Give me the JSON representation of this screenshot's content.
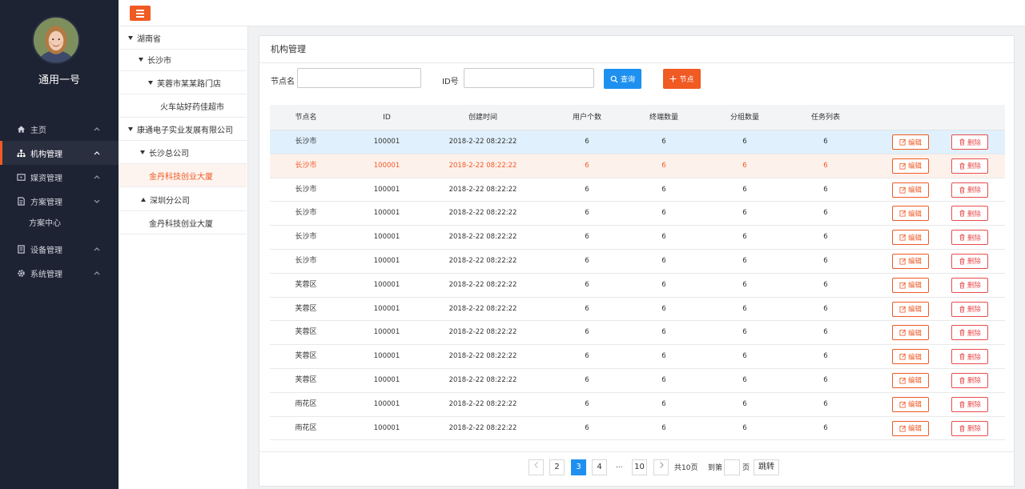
{
  "user": {
    "name": "通用一号"
  },
  "colors": {
    "accent": "#f05a23",
    "primary": "#1e90f0",
    "sidebar": "#1e2333",
    "danger": "#e84d4d"
  },
  "nav": {
    "items": [
      {
        "label": "主页",
        "icon": "home-icon"
      },
      {
        "label": "机构管理",
        "icon": "org-tree-icon"
      },
      {
        "label": "媒资管理",
        "icon": "media-icon"
      },
      {
        "label": "方案管理",
        "icon": "document-icon"
      },
      {
        "label": "方案中心"
      },
      {
        "label": "设备管理",
        "icon": "device-icon"
      },
      {
        "label": "系统管理",
        "icon": "gear-icon"
      }
    ]
  },
  "tree": {
    "nodes": [
      {
        "label": "湖南省",
        "state": "expanded"
      },
      {
        "label": "长沙市",
        "state": "expanded"
      },
      {
        "label": "芙蓉市某某路门店",
        "state": "expanded"
      },
      {
        "label": "火车站好药佳超市",
        "state": "leaf"
      },
      {
        "label": "康通电子实业发展有限公司",
        "state": "expanded"
      },
      {
        "label": "长沙总公司",
        "state": "expanded"
      },
      {
        "label": "金丹科技创业大厦",
        "state": "selected"
      },
      {
        "label": "深圳分公司",
        "state": "collapsed"
      },
      {
        "label": "金丹科技创业大厦",
        "state": "leaf"
      }
    ]
  },
  "panel": {
    "title": "机构管理"
  },
  "search": {
    "name_label": "节点名",
    "name_value": "",
    "id_label": "ID号",
    "id_value": "",
    "query_label": "查询",
    "add_label": "节点"
  },
  "table": {
    "headers": [
      "节点名",
      "ID",
      "创建时间",
      "用户个数",
      "终端数量",
      "分组数量",
      "任务列表"
    ],
    "edit_label": "编辑",
    "delete_label": "删除",
    "rows": [
      {
        "name": "长沙市",
        "id": "100001",
        "created": "2018-2-22  08:22:22",
        "users": "6",
        "terminals": "6",
        "groups": "6",
        "tasks": "6",
        "state": "hover"
      },
      {
        "name": "长沙市",
        "id": "100001",
        "created": "2018-2-22  08:22:22",
        "users": "6",
        "terminals": "6",
        "groups": "6",
        "tasks": "6",
        "state": "selected"
      },
      {
        "name": "长沙市",
        "id": "100001",
        "created": "2018-2-22  08:22:22",
        "users": "6",
        "terminals": "6",
        "groups": "6",
        "tasks": "6",
        "state": ""
      },
      {
        "name": "长沙市",
        "id": "100001",
        "created": "2018-2-22  08:22:22",
        "users": "6",
        "terminals": "6",
        "groups": "6",
        "tasks": "6",
        "state": ""
      },
      {
        "name": "长沙市",
        "id": "100001",
        "created": "2018-2-22  08:22:22",
        "users": "6",
        "terminals": "6",
        "groups": "6",
        "tasks": "6",
        "state": ""
      },
      {
        "name": "长沙市",
        "id": "100001",
        "created": "2018-2-22  08:22:22",
        "users": "6",
        "terminals": "6",
        "groups": "6",
        "tasks": "6",
        "state": ""
      },
      {
        "name": "芙蓉区",
        "id": "100001",
        "created": "2018-2-22  08:22:22",
        "users": "6",
        "terminals": "6",
        "groups": "6",
        "tasks": "6",
        "state": ""
      },
      {
        "name": "芙蓉区",
        "id": "100001",
        "created": "2018-2-22  08:22:22",
        "users": "6",
        "terminals": "6",
        "groups": "6",
        "tasks": "6",
        "state": ""
      },
      {
        "name": "芙蓉区",
        "id": "100001",
        "created": "2018-2-22  08:22:22",
        "users": "6",
        "terminals": "6",
        "groups": "6",
        "tasks": "6",
        "state": ""
      },
      {
        "name": "芙蓉区",
        "id": "100001",
        "created": "2018-2-22  08:22:22",
        "users": "6",
        "terminals": "6",
        "groups": "6",
        "tasks": "6",
        "state": ""
      },
      {
        "name": "芙蓉区",
        "id": "100001",
        "created": "2018-2-22  08:22:22",
        "users": "6",
        "terminals": "6",
        "groups": "6",
        "tasks": "6",
        "state": ""
      },
      {
        "name": "雨花区",
        "id": "100001",
        "created": "2018-2-22  08:22:22",
        "users": "6",
        "terminals": "6",
        "groups": "6",
        "tasks": "6",
        "state": ""
      },
      {
        "name": "雨花区",
        "id": "100001",
        "created": "2018-2-22  08:22:22",
        "users": "6",
        "terminals": "6",
        "groups": "6",
        "tasks": "6",
        "state": ""
      }
    ]
  },
  "pagination": {
    "pages": [
      "2",
      "3",
      "4",
      "...",
      "10"
    ],
    "current": "3",
    "total_text": "共10页",
    "goto_label": "到第",
    "page_unit": "页",
    "jump_label": "跳转"
  }
}
